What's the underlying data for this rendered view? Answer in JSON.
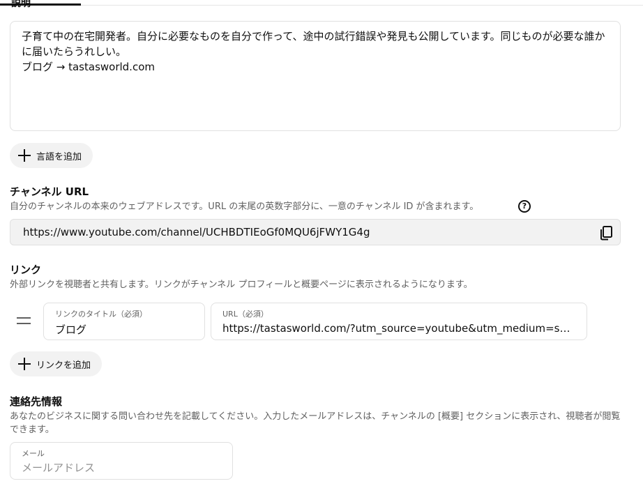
{
  "description": {
    "label": "説明",
    "text": "子育て中の在宅開発者。自分に必要なものを自分で作って、途中の試行錯誤や発見も公開しています。同じものが必要な誰かに届いたらうれしい。\nブログ → tastasworld.com",
    "add_language_label": "言語を追加"
  },
  "channel_url": {
    "title": "チャンネル URL",
    "subtitle": "自分のチャンネルの本来のウェブアドレスです。URL の末尾の英数字部分に、一意のチャンネル ID が含まれます。",
    "help_glyph": "?",
    "value": "https://www.youtube.com/channel/UCHBDTIEoGf0MQU6jFWY1G4g"
  },
  "links": {
    "title": "リンク",
    "subtitle": "外部リンクを視聴者と共有します。リンクがチャンネル プロフィールと概要ページに表示されるようになります。",
    "items": [
      {
        "title_label": "リンクのタイトル（必須）",
        "title_value": "ブログ",
        "url_label": "URL（必須）",
        "url_value": "https://tastasworld.com/?utm_source=youtube&utm_medium=social&utm_campaign=profile"
      }
    ],
    "add_link_label": "リンクを追加"
  },
  "contact": {
    "title": "連絡先情報",
    "subtitle": "あなたのビジネスに関する問い合わせ先を記載してください。入力したメールアドレスは、チャンネルの [概要] セクションに表示され、視聴者が閲覧できます。",
    "email_label": "メール",
    "email_placeholder": "メールアドレス",
    "email_value": ""
  }
}
